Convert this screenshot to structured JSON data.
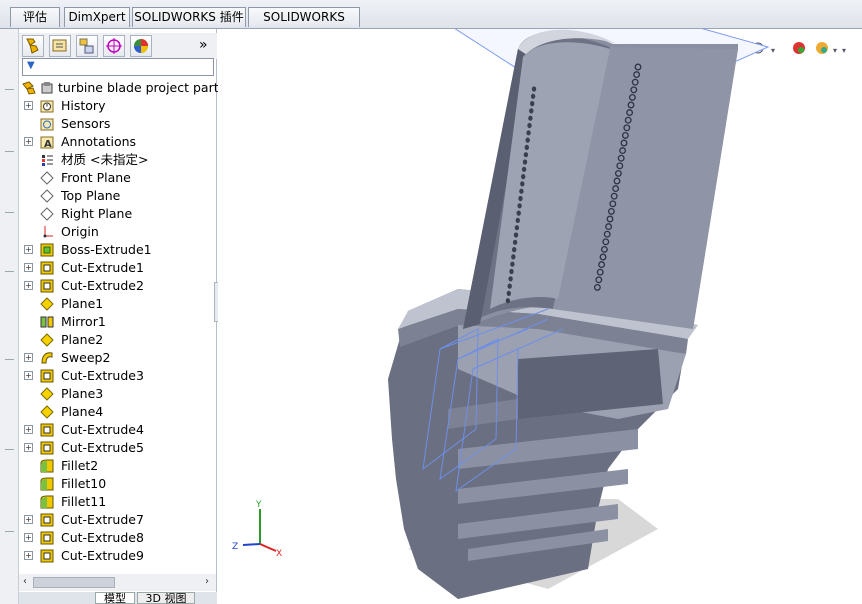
{
  "tabs": [
    "评估",
    "DimXpert",
    "SOLIDWORKS 插件",
    "SOLIDWORKS MBD"
  ],
  "feature_tree": {
    "root": "turbine blade project part",
    "items": [
      {
        "label": "History",
        "icon": "history-icon",
        "expand": true
      },
      {
        "label": "Sensors",
        "icon": "sensors-icon",
        "expand": false
      },
      {
        "label": "Annotations",
        "icon": "annotations-icon",
        "expand": true
      },
      {
        "label": "材质 <未指定>",
        "icon": "material-icon",
        "expand": false
      },
      {
        "label": "Front Plane",
        "icon": "plane-icon",
        "expand": false
      },
      {
        "label": "Top Plane",
        "icon": "plane-icon",
        "expand": false
      },
      {
        "label": "Right Plane",
        "icon": "plane-icon",
        "expand": false
      },
      {
        "label": "Origin",
        "icon": "origin-icon",
        "expand": false
      },
      {
        "label": "Boss-Extrude1",
        "icon": "boss-extrude-icon",
        "expand": true
      },
      {
        "label": "Cut-Extrude1",
        "icon": "cut-extrude-icon",
        "expand": true
      },
      {
        "label": "Cut-Extrude2",
        "icon": "cut-extrude-icon",
        "expand": true
      },
      {
        "label": "Plane1",
        "icon": "plane-feature-icon",
        "expand": false
      },
      {
        "label": "Mirror1",
        "icon": "mirror-icon",
        "expand": false
      },
      {
        "label": "Plane2",
        "icon": "plane-feature-icon",
        "expand": false
      },
      {
        "label": "Sweep2",
        "icon": "sweep-icon",
        "expand": true
      },
      {
        "label": "Cut-Extrude3",
        "icon": "cut-extrude-icon",
        "expand": true
      },
      {
        "label": "Plane3",
        "icon": "plane-feature-icon",
        "expand": false
      },
      {
        "label": "Plane4",
        "icon": "plane-feature-icon",
        "expand": false
      },
      {
        "label": "Cut-Extrude4",
        "icon": "cut-extrude-icon",
        "expand": true
      },
      {
        "label": "Cut-Extrude5",
        "icon": "cut-extrude-icon",
        "expand": true
      },
      {
        "label": "Fillet2",
        "icon": "fillet-icon",
        "expand": false
      },
      {
        "label": "Fillet10",
        "icon": "fillet-icon",
        "expand": false
      },
      {
        "label": "Fillet11",
        "icon": "fillet-icon",
        "expand": false
      },
      {
        "label": "Cut-Extrude7",
        "icon": "cut-extrude-icon",
        "expand": true
      },
      {
        "label": "Cut-Extrude8",
        "icon": "cut-extrude-icon",
        "expand": true
      },
      {
        "label": "Cut-Extrude9",
        "icon": "cut-extrude-icon",
        "expand": true
      }
    ]
  },
  "bottom_tabs": [
    "模型",
    "3D 视图"
  ],
  "triad": {
    "x": "X",
    "y": "Y",
    "z": "Z"
  },
  "expander_glyph": "»",
  "filter_glyph": "▼",
  "colors": {
    "model": "#6b7183",
    "plane": "#6f8fe6",
    "accent": "#3a62b8"
  }
}
